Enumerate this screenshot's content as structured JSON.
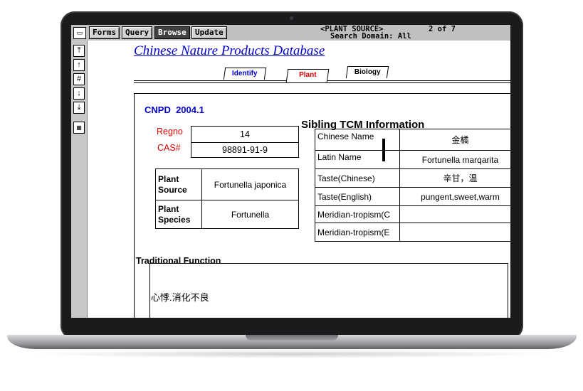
{
  "menubar": {
    "buttons": [
      "Forms",
      "Query",
      "Browse",
      "Update"
    ],
    "active": "Browse",
    "status_line1": "<PLANT SOURCE>",
    "status_line2": "Search Domain: All",
    "record_pos": "2 of 7"
  },
  "toolstrip": {
    "icons": [
      "first-record-icon",
      "prev-record-icon",
      "goto-record-icon",
      "next-record-icon",
      "last-record-icon",
      "keypad-icon"
    ]
  },
  "database_title": "Chinese Nature Products Database",
  "tabs": [
    {
      "label": "Identify",
      "color": "#0000cc"
    },
    {
      "label": "Plant",
      "color": "#dd0000"
    },
    {
      "label": "Biology",
      "color": "#000000"
    }
  ],
  "record": {
    "cnpd_label": "CNPD",
    "cnpd_version": "2004.1",
    "regno_label": "Regno",
    "regno_value": "14",
    "cas_label": "CAS#",
    "cas_value": "98891-91-9",
    "plant_source_label": "Plant Source",
    "plant_source_value": "Fortunella japonica",
    "plant_species_label": "Plant Species",
    "plant_species_value": "Fortunella"
  },
  "sibling_tcm": {
    "heading": "Sibling TCM Information",
    "rows": [
      {
        "label": "Chinese Name",
        "value": "金橘"
      },
      {
        "label": "Latin Name",
        "value": "Fortunella marqarita"
      },
      {
        "label": "Taste(Chinese)",
        "value": "辛甘，温"
      },
      {
        "label": "Taste(English)",
        "value": "pungent,sweet,warm"
      },
      {
        "label": "Meridian-tropism(C",
        "value": ""
      },
      {
        "label": "Meridian-tropism(E",
        "value": ""
      }
    ]
  },
  "traditional_function": {
    "heading": "Traditional Function",
    "text": "心悸.消化不良"
  },
  "colors": {
    "title_blue": "#0000cc",
    "label_red": "#dd0000",
    "chrome_gray": "#c0c0c0"
  }
}
